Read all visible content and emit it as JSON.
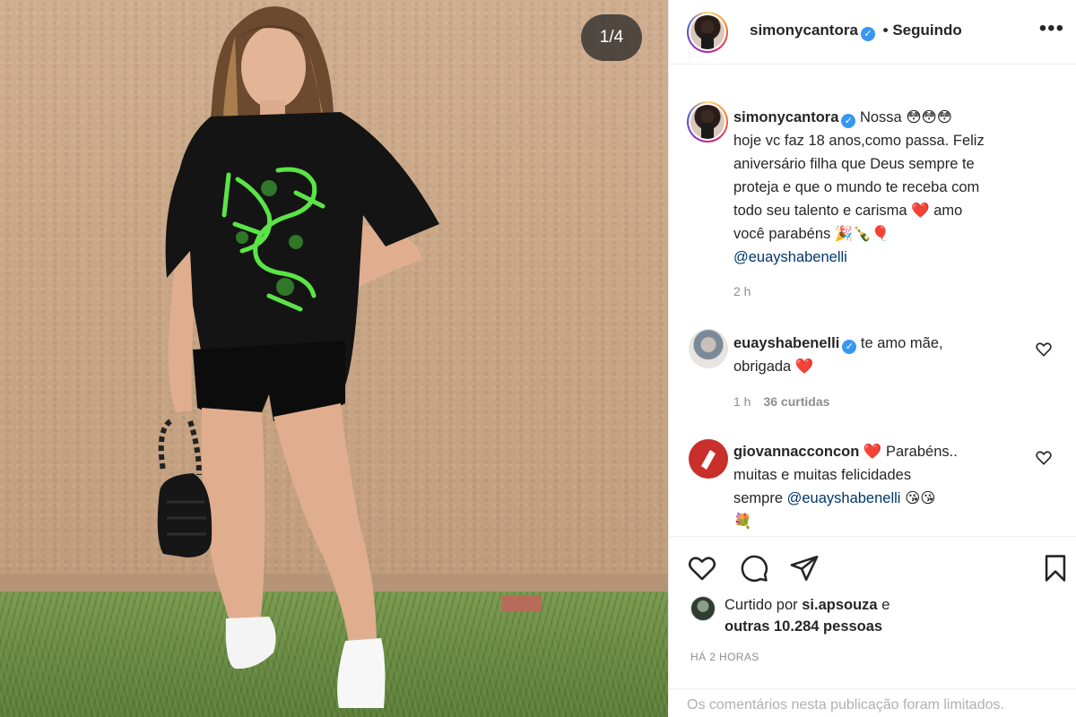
{
  "photo": {
    "counter": "1/4"
  },
  "post": {
    "author": "simonycantora",
    "follow_status": "• Seguindo",
    "more_label": "•••"
  },
  "caption": {
    "username": "simonycantora",
    "line1": "Nossa 😳😳😳",
    "line2": "hoje vc faz 18 anos,como passa. Feliz",
    "line3": "aniversário filha que Deus sempre te",
    "line4": "proteja e que o mundo te receba com",
    "line5": "todo seu talento e carisma ❤️ amo",
    "line6": "você parabéns 🎉🍾🎈",
    "mention": "@euayshabenelli",
    "time": "2 h"
  },
  "comments": [
    {
      "username": "euayshabenelli",
      "line1": "te amo mãe,",
      "line2": "obrigada ❤️",
      "time": "1 h",
      "likes": "36 curtidas"
    },
    {
      "username": "giovannacconcon",
      "line1_rest": "❤️ Parabéns..",
      "line2": "muitas e muitas felicidades",
      "line3_prefix": "sempre",
      "mention": "@euayshabenelli",
      "line3_suffix": "😘😘",
      "line4": "💐"
    }
  ],
  "likes": {
    "prefix": "Curtido por",
    "user": "si.apsouza",
    "joiner": "e",
    "others": "outras 10.284 pessoas"
  },
  "time_ago": "HÁ 2 HORAS",
  "limited_notice": "Os comentários nesta publicação foram limitados."
}
